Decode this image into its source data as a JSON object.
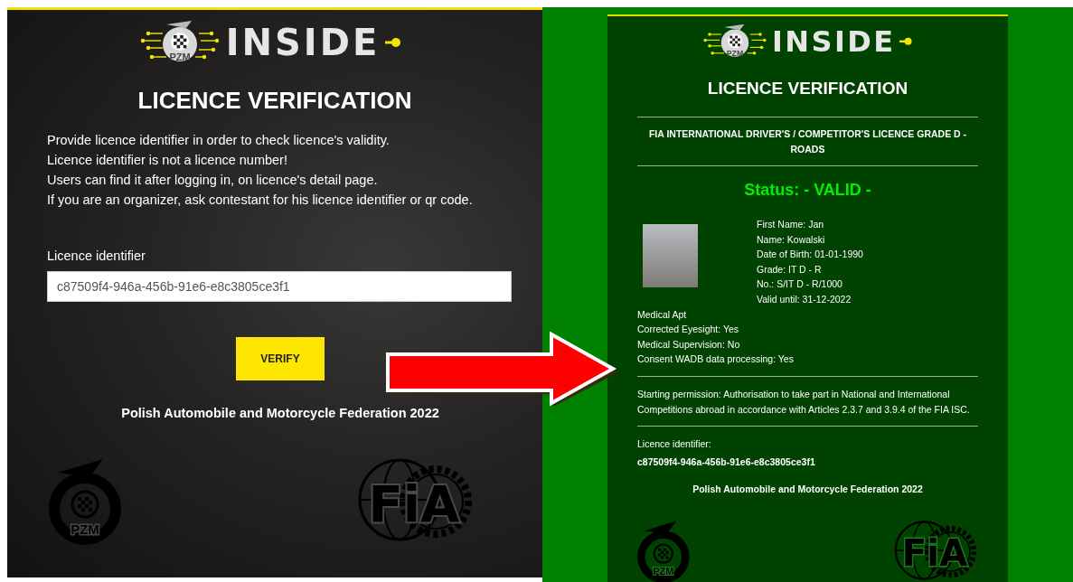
{
  "verify_page": {
    "logo": {
      "text": "INSIDE",
      "badge": "PZM"
    },
    "title": "LICENCE VERIFICATION",
    "instructions": [
      "Provide licence identifier in order to check licence's validity.",
      "Licence identifier is not a licence number!",
      "Users can find it after logging in, on licence's detail page.",
      "If you are an organizer, ask contestant for his licence identifier or qr code."
    ],
    "identifier_field": {
      "label": "Licence identifier",
      "value": "c87509f4-946a-456b-91e6-e8c3805ce3f1"
    },
    "verify_button": "VERIFY",
    "footer": "Polish Automobile and Motorcycle Federation 2022",
    "footer_logos": {
      "pzm": "PZM",
      "fia": "FiA"
    }
  },
  "result_page": {
    "logo": {
      "text": "INSIDE",
      "badge": "PZM"
    },
    "title": "LICENCE VERIFICATION",
    "licence_type": "FIA INTERNATIONAL DRIVER'S / COMPETITOR'S LICENCE GRADE D - ROADS",
    "status": {
      "text": "Status: - VALID -",
      "valid": true
    },
    "personal_details": [
      "First Name: Jan",
      "Name: Kowalski",
      "Date of Birth: 01-01-1990",
      "Grade: IT D - R",
      "No.: S/IT D - R/1000",
      "Valid until: 31-12-2022"
    ],
    "medical": [
      "Medical Apt",
      "Corrected Eyesight: Yes",
      "Medical Supervision: No",
      "Consent WADB data processing: Yes"
    ],
    "starting_permission": "Starting permission: Authorisation to take part in National and International Competitions abroad in accordance with Articles 2.3.7 and 3.9.4 of the FIA ISC.",
    "identifier_label": "Licence identifier:",
    "identifier": "c87509f4-946a-456b-91e6-e8c3805ce3f1",
    "footer": "Polish Automobile and Motorcycle Federation 2022",
    "footer_logos": {
      "pzm": "PZM",
      "fia": "FiA"
    }
  }
}
